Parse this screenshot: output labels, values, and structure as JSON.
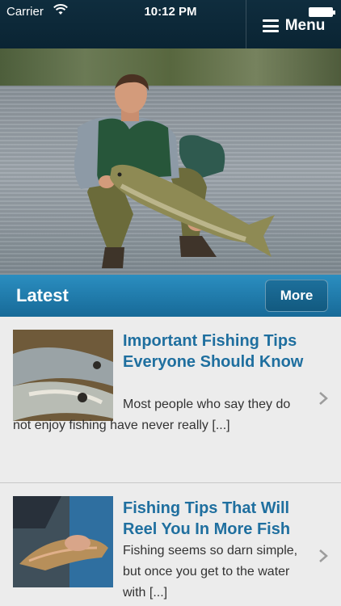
{
  "status_bar": {
    "carrier": "Carrier",
    "time": "10:12 PM"
  },
  "nav": {
    "menu_label": "Menu"
  },
  "hero": {
    "icon": "photo-man-holding-fish"
  },
  "section": {
    "title": "Latest",
    "more_label": "More"
  },
  "articles": [
    {
      "title": "Important Fishing Tips Everyone Should Know",
      "snippet": "Most people who say they do not enjoy fishing have never really [...]"
    },
    {
      "title": "Fishing Tips That Will Reel You In More Fish",
      "snippet": "Fishing seems so darn simple, but once you get to the water with [...]"
    }
  ],
  "colors": {
    "nav_bg": "#0f2d3e",
    "section_bar": "#2b8ec0",
    "title_link": "#1f6f9f",
    "page_bg": "#ececec"
  }
}
